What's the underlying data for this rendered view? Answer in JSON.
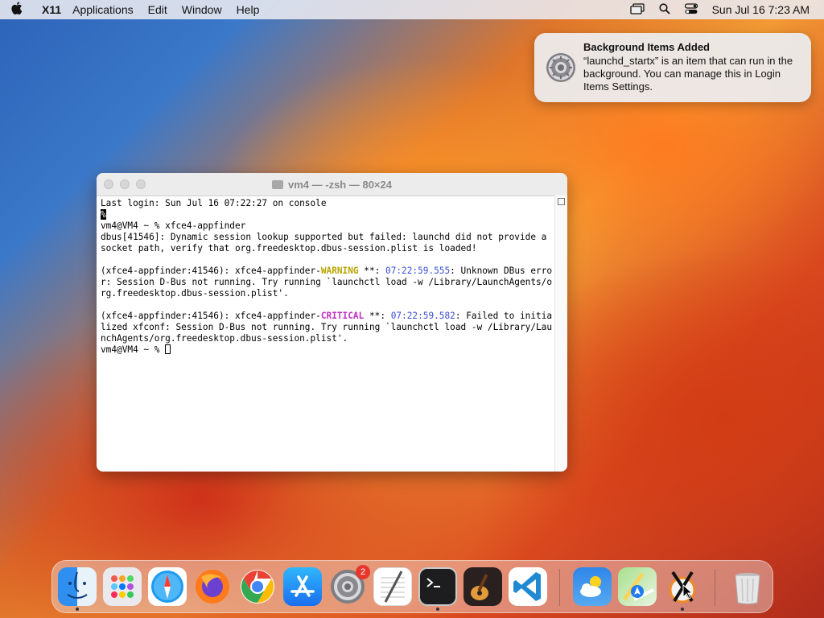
{
  "menubar": {
    "app_name": "X11",
    "items": [
      "Applications",
      "Edit",
      "Window",
      "Help"
    ],
    "clock": "Sun Jul 16  7:23 AM"
  },
  "notification": {
    "title": "Background Items Added",
    "body": "“launchd_startx” is an item that can run in the background. You can manage this in Login Items Settings."
  },
  "terminal": {
    "title": "vm4 — -zsh — 80×24",
    "lines": {
      "l1": "Last login: Sun Jul 16 07:22:27 on console",
      "l2": "%",
      "l3": "vm4@VM4 ~ % xfce4-appfinder",
      "l4": "dbus[41546]: Dynamic session lookup supported but failed: launchd did not provide a socket path, verify that org.freedesktop.dbus-session.plist is loaded!",
      "l6a": "(xfce4-appfinder:41546): xfce4-appfinder-",
      "l6b": "WARNING",
      "l6c": " **: ",
      "l6d": "07:22:59.555",
      "l6e": ": Unknown DBus error: Session D-Bus not running. Try running `launchctl load -w /Library/LaunchAgents/org.freedesktop.dbus-session.plist'.",
      "l8a": "(xfce4-appfinder:41546): xfce4-appfinder-",
      "l8b": "CRITICAL",
      "l8c": " **: ",
      "l8d": "07:22:59.582",
      "l8e": ": Failed to initialized xfconf: Session D-Bus not running. Try running `launchctl load -w /Library/LaunchAgents/org.freedesktop.dbus-session.plist'.",
      "l9": "vm4@VM4 ~ % "
    }
  },
  "dock": {
    "items": [
      "finder-icon",
      "launchpad-icon",
      "safari-icon",
      "firefox-icon",
      "chrome-icon",
      "app-store-icon",
      "system-settings-icon",
      "textedit-icon",
      "terminal-icon",
      "garageband-icon",
      "vscode-icon",
      "weather-icon",
      "maps-icon",
      "x11-icon",
      "trash-icon"
    ],
    "settings_badge": "2"
  },
  "colors": {
    "warning": "#b9a400",
    "critical": "#c12fc1",
    "timestamp": "#3a4fd1"
  }
}
